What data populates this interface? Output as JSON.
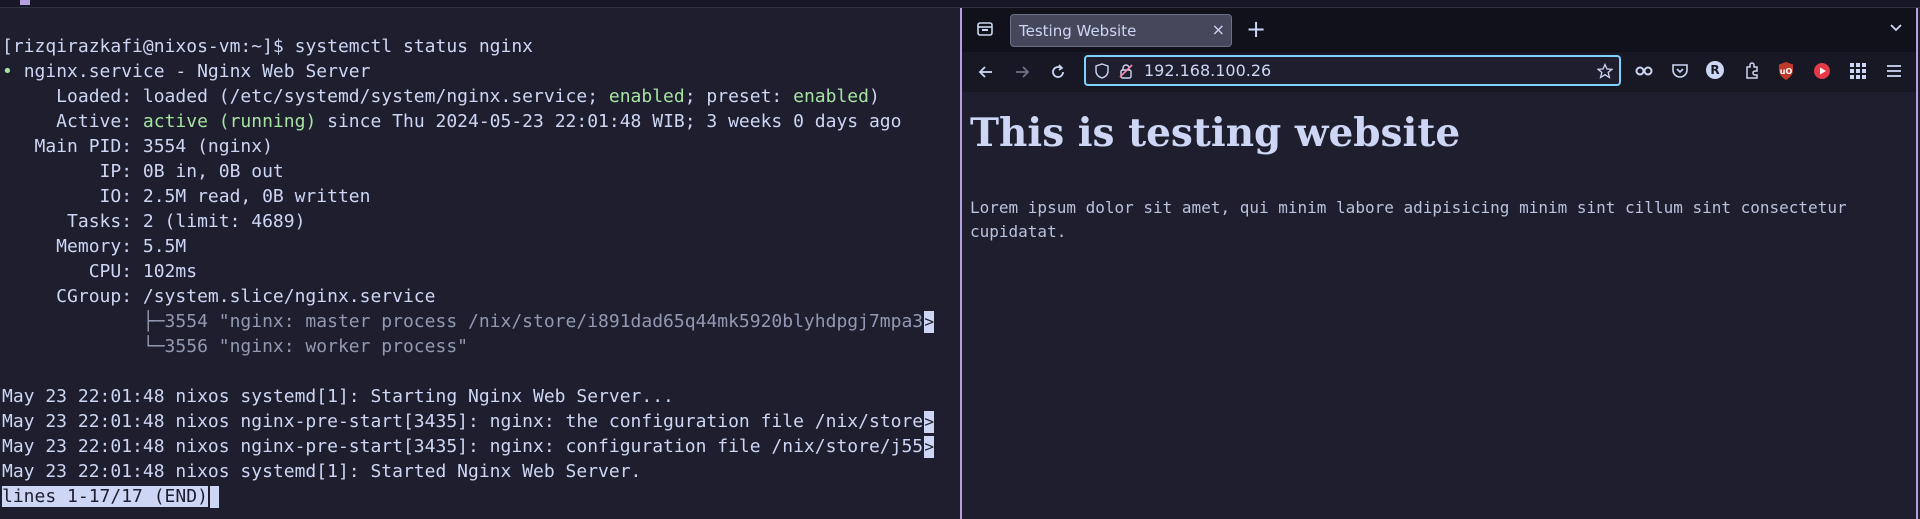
{
  "terminal": {
    "prompt": "[rizqirazkafi@nixos-vm:~]$ ",
    "command": "systemctl status nginx",
    "service_bullet": "• ",
    "service_line": "nginx.service - Nginx Web Server",
    "loaded_prefix": "     Loaded: loaded (/etc/systemd/system/nginx.service; ",
    "loaded_enabled": "enabled",
    "loaded_mid": "; preset: ",
    "loaded_preset": "enabled",
    "loaded_suffix": ")",
    "active_prefix": "     Active: ",
    "active_state": "active (running)",
    "active_suffix": " since Thu 2024-05-23 22:01:48 WIB; 3 weeks 0 days ago",
    "main_pid": "   Main PID: 3554 (nginx)",
    "ip": "         IP: 0B in, 0B out",
    "io": "         IO: 2.5M read, 0B written",
    "tasks": "      Tasks: 2 (limit: 4689)",
    "memory": "     Memory: 5.5M",
    "cpu": "        CPU: 102ms",
    "cgroup": "     CGroup: /system.slice/nginx.service",
    "proc1": "             ├─3554 \"nginx: master process /nix/store/i891dad65q44mk5920blyhdpgj7mpa3",
    "proc2": "             └─3556 \"nginx: worker process\"",
    "log1": "May 23 22:01:48 nixos systemd[1]: Starting Nginx Web Server...",
    "log2": "May 23 22:01:48 nixos nginx-pre-start[3435]: nginx: the configuration file /nix/store",
    "log3": "May 23 22:01:48 nixos nginx-pre-start[3435]: nginx: configuration file /nix/store/j55",
    "log4": "May 23 22:01:48 nixos systemd[1]: Started Nginx Web Server.",
    "status": "lines 1-17/17 (END)",
    "overflow_glyph": ">"
  },
  "browser": {
    "tab_title": "Testing Website",
    "tab_close": "×",
    "new_tab": "+",
    "url": "192.168.100.26",
    "page_heading": "This is testing website",
    "page_paragraph": "Lorem ipsum dolor sit amet, qui minim labore adipisicing minim sint cillum sint consectetur cupidatat.",
    "extension_letter": "R"
  },
  "colors": {
    "background": "#1e1e2e",
    "accent": "#b4a0e0",
    "green": "#a6e3a1",
    "urlbar_focus": "#7dd3fc"
  }
}
